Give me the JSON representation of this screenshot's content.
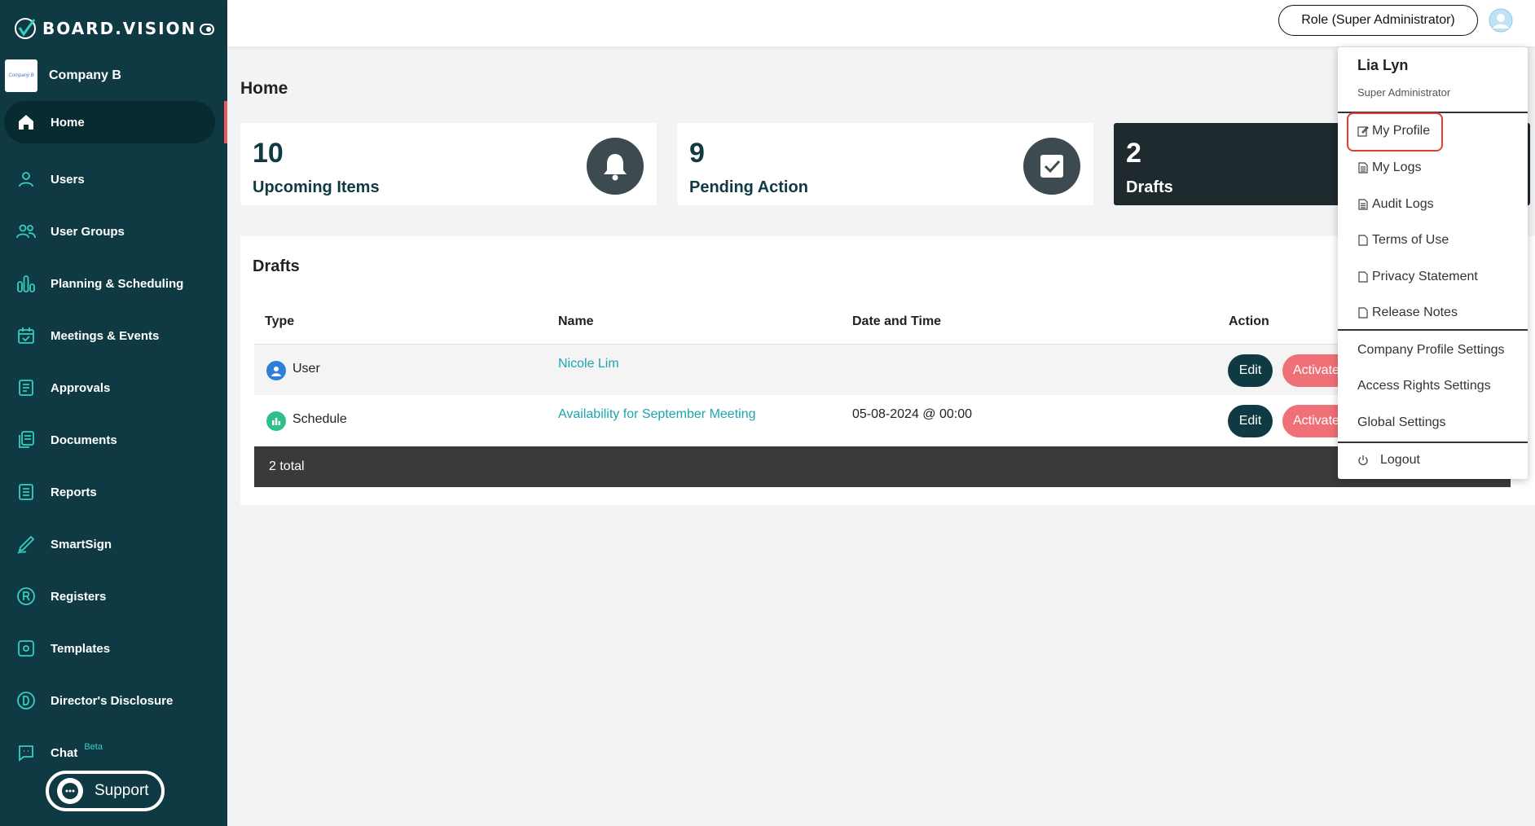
{
  "brand": {
    "name": "BOARD.VISION"
  },
  "company": {
    "name": "Company B",
    "logo_text": "Company B"
  },
  "sidebar": {
    "items": [
      {
        "label": "Home",
        "icon": "home-icon"
      },
      {
        "label": "Users",
        "icon": "user-icon"
      },
      {
        "label": "User Groups",
        "icon": "users-icon"
      },
      {
        "label": "Planning & Scheduling",
        "icon": "bar-chart-icon"
      },
      {
        "label": "Meetings & Events",
        "icon": "calendar-icon"
      },
      {
        "label": "Approvals",
        "icon": "approvals-icon"
      },
      {
        "label": "Documents",
        "icon": "documents-icon"
      },
      {
        "label": "Reports",
        "icon": "reports-icon"
      },
      {
        "label": "SmartSign",
        "icon": "pen-icon"
      },
      {
        "label": "Registers",
        "icon": "registered-icon"
      },
      {
        "label": "Templates",
        "icon": "template-icon"
      },
      {
        "label": "Director's Disclosure",
        "icon": "disclosure-icon"
      },
      {
        "label": "Chat",
        "icon": "chat-icon",
        "badge": "Beta"
      }
    ],
    "support_label": "Support"
  },
  "header": {
    "role_label": "Role (Super Administrator)"
  },
  "main": {
    "title": "Home",
    "cards": [
      {
        "number": "10",
        "label": "Upcoming Items",
        "icon": "bell-icon"
      },
      {
        "number": "9",
        "label": "Pending Action",
        "icon": "check-square-icon"
      },
      {
        "number": "2",
        "label": "Drafts"
      }
    ],
    "drafts": {
      "title": "Drafts",
      "columns": [
        "Type",
        "Name",
        "Date and Time",
        "Action"
      ],
      "rows": [
        {
          "type": "User",
          "name": "Nicole Lim",
          "datetime": "",
          "edit": "Edit",
          "activate": "Activate"
        },
        {
          "type": "Schedule",
          "name": "Availability for September Meeting",
          "datetime": "05-08-2024 @ 00:00",
          "edit": "Edit",
          "activate": "Activate"
        }
      ],
      "total": "2 total"
    }
  },
  "dropdown": {
    "user_name": "Lia Lyn",
    "user_role": "Super Administrator",
    "items_a": [
      "My Profile",
      "My Logs",
      "Audit Logs",
      "Terms of Use",
      "Privacy Statement",
      "Release Notes"
    ],
    "items_b": [
      "Company Profile Settings",
      "Access Rights Settings",
      "Global Settings"
    ],
    "logout": "Logout"
  },
  "colors": {
    "sidebar": "#0f3a43",
    "accent": "#1aa6b0",
    "danger": "#f07078",
    "highlight": "#e04030"
  }
}
